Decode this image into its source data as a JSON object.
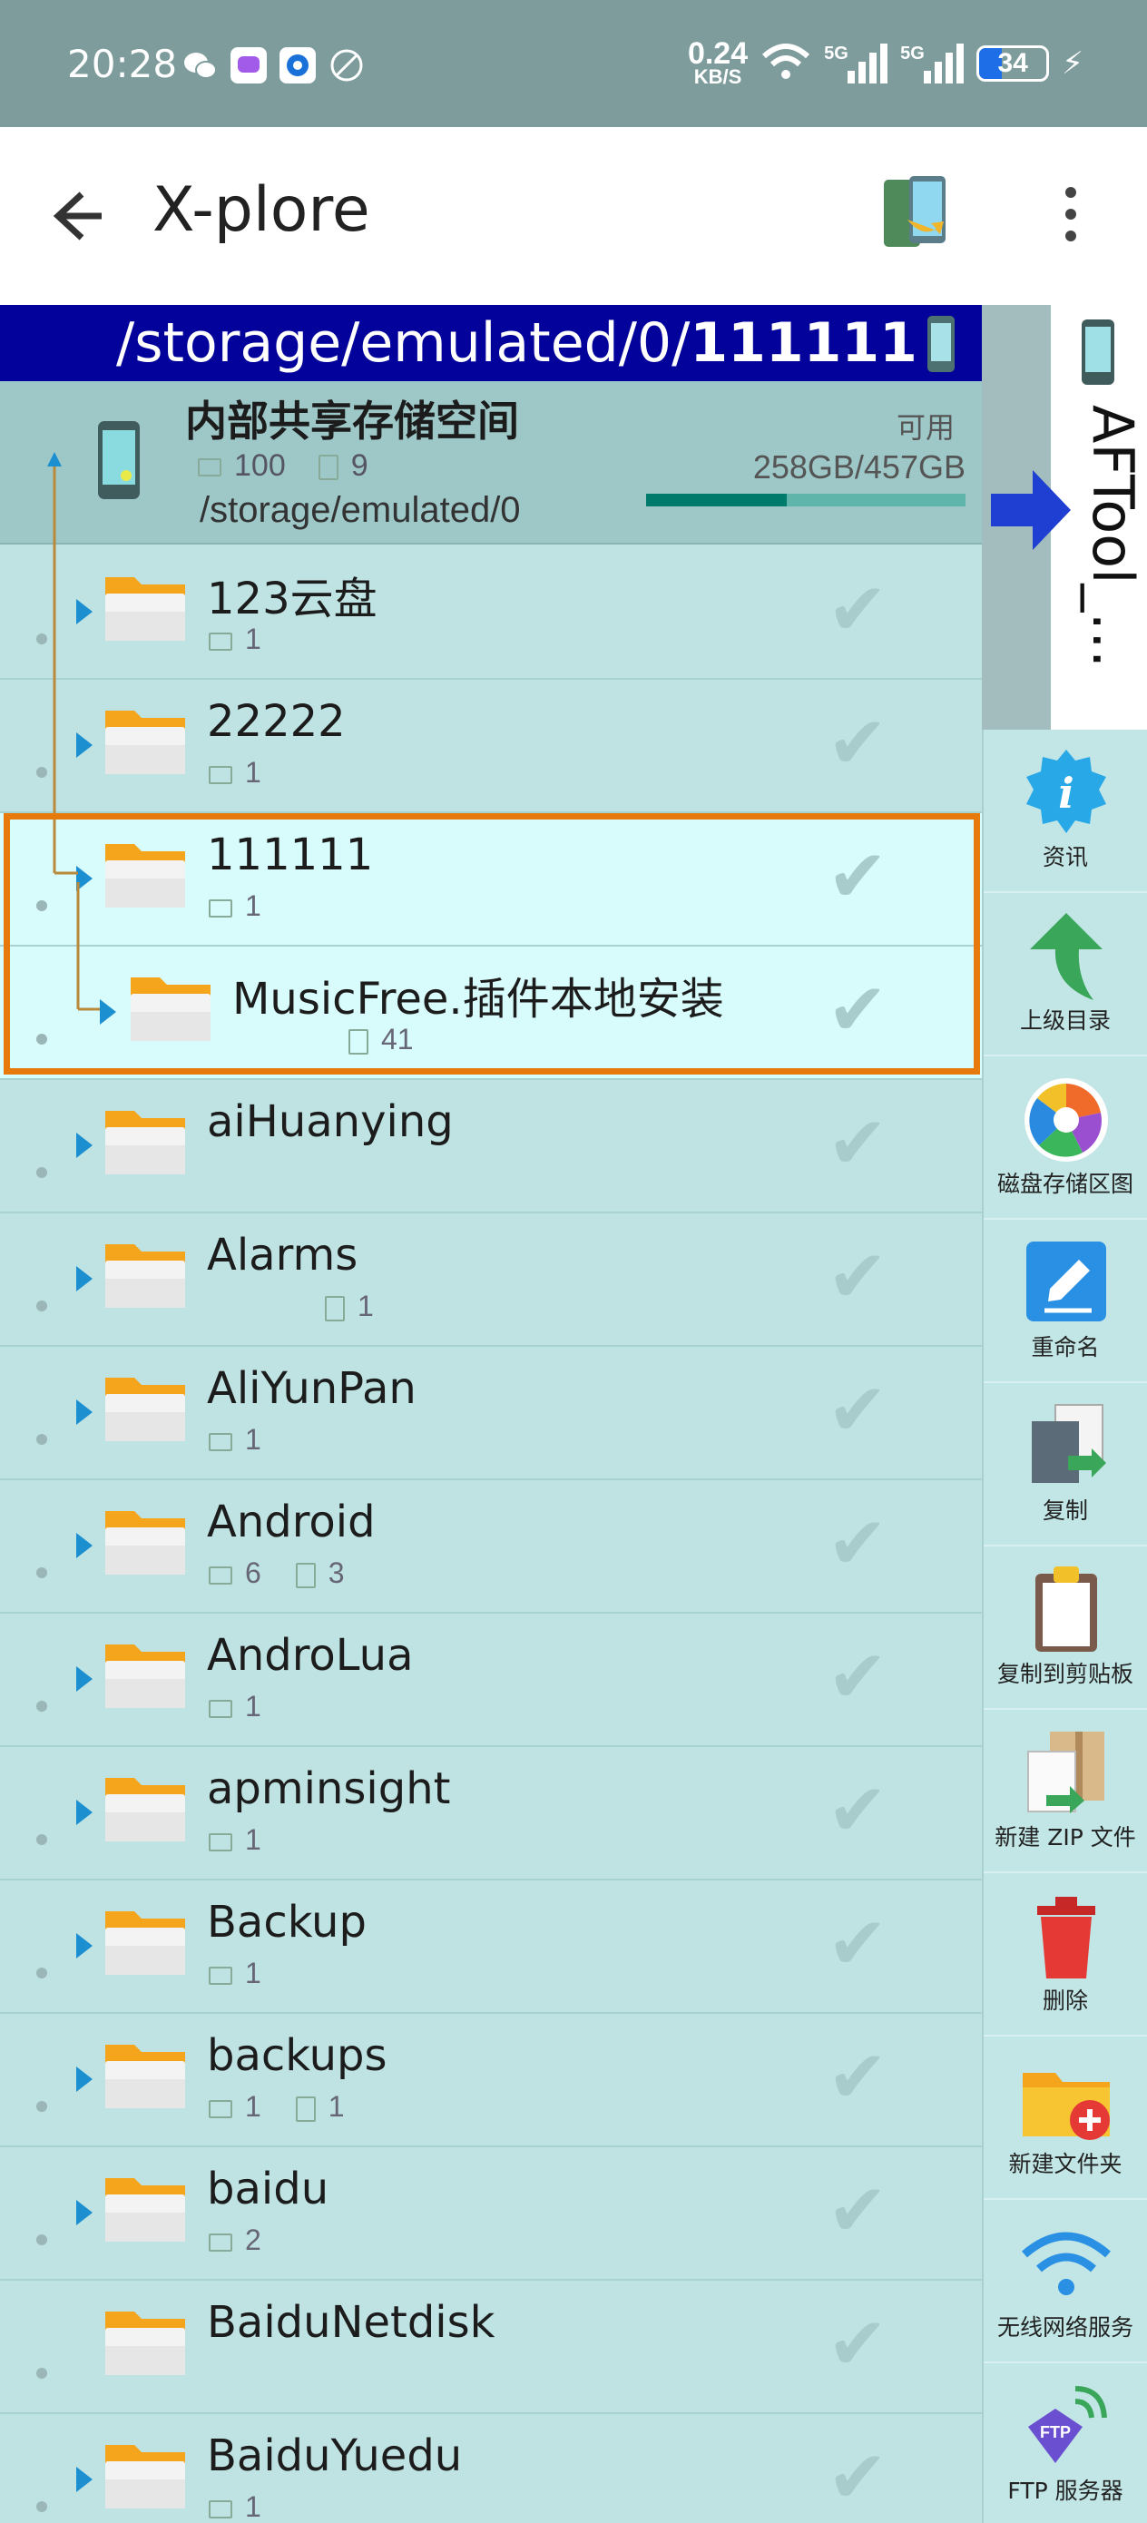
{
  "status_bar": {
    "time": "20:28",
    "net_speed_value": "0.24",
    "net_speed_unit": "KB/S",
    "sim1": "5G",
    "sim2": "5G",
    "battery": "34"
  },
  "app_bar": {
    "title": "X-plore"
  },
  "path_bar": {
    "prefix": "/storage/emulated/0/",
    "current": "111111"
  },
  "storage": {
    "name": "内部共享存储空间",
    "folders": "100",
    "files": "9",
    "path": "/storage/emulated/0",
    "available_label": "可用",
    "size": "258GB/457GB",
    "used_fraction": 0.44
  },
  "rows": [
    {
      "name": "123云盘",
      "folders": "1",
      "files": ""
    },
    {
      "name": "22222",
      "folders": "1",
      "files": ""
    },
    {
      "name": "111111",
      "folders": "1",
      "files": ""
    },
    {
      "name": "MusicFree.插件本地安装",
      "folders": "",
      "files": "41"
    },
    {
      "name": "aiHuanying",
      "folders": "",
      "files": ""
    },
    {
      "name": "Alarms",
      "folders": "",
      "files": "1"
    },
    {
      "name": "AliYunPan",
      "folders": "1",
      "files": ""
    },
    {
      "name": "Android",
      "folders": "6",
      "files": "3"
    },
    {
      "name": "AndroLua",
      "folders": "1",
      "files": ""
    },
    {
      "name": "apminsight",
      "folders": "1",
      "files": ""
    },
    {
      "name": "Backup",
      "folders": "1",
      "files": ""
    },
    {
      "name": "backups",
      "folders": "1",
      "files": "1"
    },
    {
      "name": "baidu",
      "folders": "2",
      "files": ""
    },
    {
      "name": "BaiduNetdisk",
      "folders": "",
      "files": ""
    },
    {
      "name": "BaiduYuedu",
      "folders": "1",
      "files": ""
    }
  ],
  "side_tab": {
    "label": "AFTool_…"
  },
  "sidebar": [
    {
      "label": "资讯",
      "icon": "info-icon"
    },
    {
      "label": "上级目录",
      "icon": "up-arrow-icon"
    },
    {
      "label": "磁盘存储区图",
      "icon": "disk-map-icon"
    },
    {
      "label": "重命名",
      "icon": "rename-icon"
    },
    {
      "label": "复制",
      "icon": "copy-icon"
    },
    {
      "label": "复制到剪贴板",
      "icon": "clipboard-icon"
    },
    {
      "label": "新建 ZIP 文件",
      "icon": "zip-icon"
    },
    {
      "label": "删除",
      "icon": "trash-icon"
    },
    {
      "label": "新建文件夹",
      "icon": "new-folder-icon"
    },
    {
      "label": "无线网络服务",
      "icon": "wifi-icon"
    },
    {
      "label": "FTP 服务器",
      "icon": "ftp-icon"
    }
  ]
}
